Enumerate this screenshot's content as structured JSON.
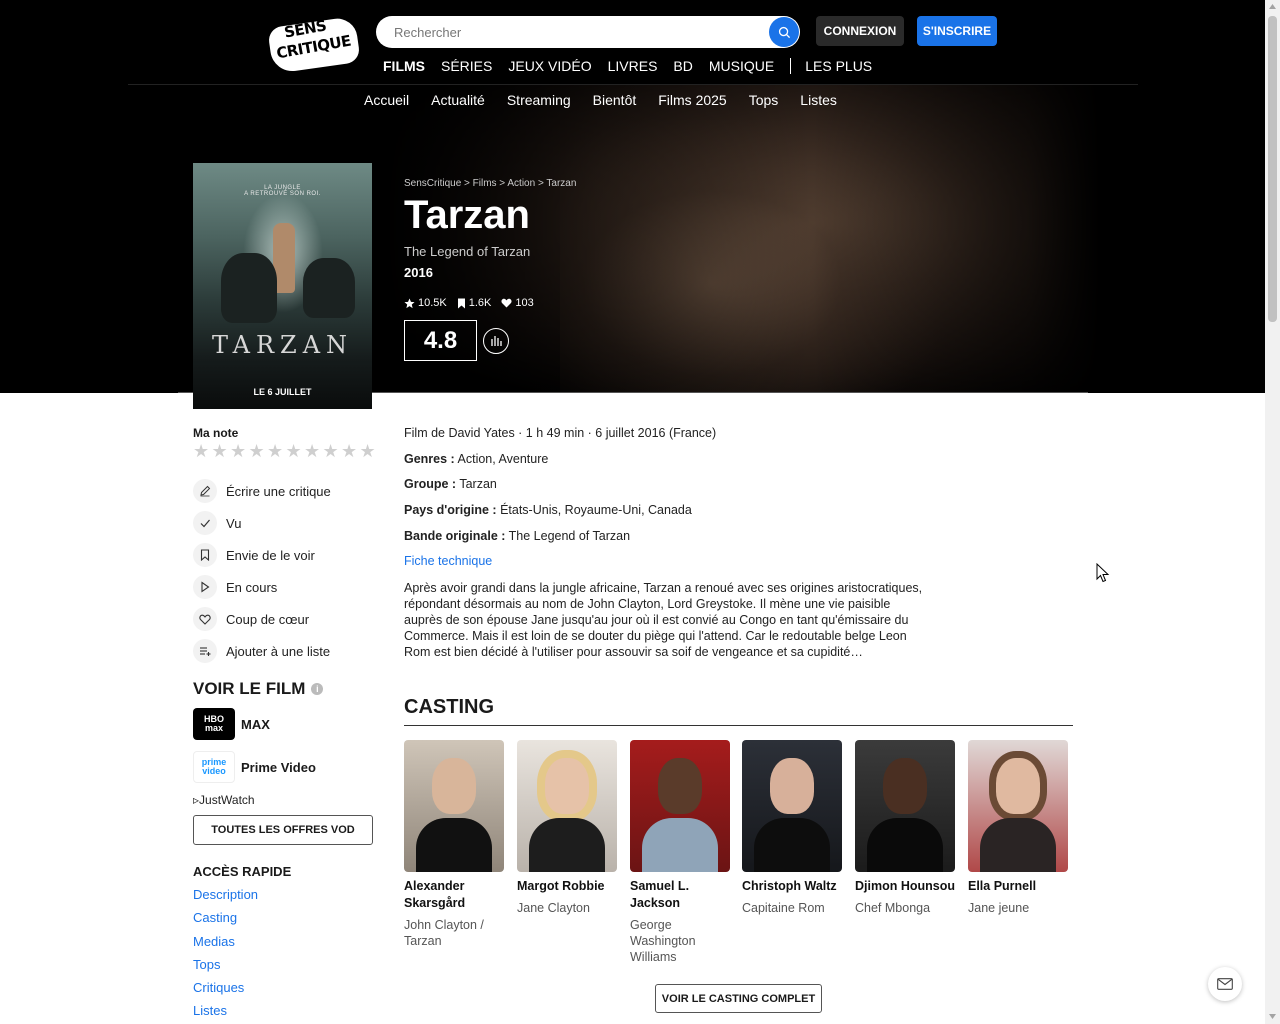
{
  "header": {
    "logo_line1": "SENS",
    "logo_line2": "CRITIQUE",
    "search_placeholder": "Rechercher",
    "login_label": "CONNEXION",
    "signup_label": "S'INSCRIRE",
    "main_nav": [
      "FILMS",
      "SÉRIES",
      "JEUX VIDÉO",
      "LIVRES",
      "BD",
      "MUSIQUE",
      "LES PLUS"
    ],
    "sub_nav": [
      "Accueil",
      "Actualité",
      "Streaming",
      "Bientôt",
      "Films 2025",
      "Tops",
      "Listes"
    ]
  },
  "poster": {
    "tagline_line1": "LA JUNGLE",
    "tagline_line2": "A RETROUVÉ SON ROI.",
    "title": "TARZAN",
    "date": "LE 6 JUILLET"
  },
  "film": {
    "breadcrumb": "SensCritique > Films > Action > Tarzan",
    "title": "Tarzan",
    "original_title": "The Legend of Tarzan",
    "year": "2016",
    "ratings_count": "10.5K",
    "wishlist_count": "1.6K",
    "favorites_count": "103",
    "average_rating": "4.8",
    "meta": "Film de David Yates · 1 h 49 min · 6 juillet 2016 (France)",
    "genres_label": "Genres :",
    "genres": "Action, Aventure",
    "group_label": "Groupe :",
    "group": "Tarzan",
    "countries_label": "Pays d'origine :",
    "countries": "États-Unis, Royaume-Uni, Canada",
    "soundtrack_label": "Bande originale :",
    "soundtrack": "The Legend of Tarzan",
    "fiche_link": "Fiche technique",
    "synopsis": "Après avoir grandi dans la jungle africaine, Tarzan a renoué avec ses origines aristocratiques, répondant désormais au nom de John Clayton, Lord Greystoke. Il mène une vie paisible auprès de son épouse Jane jusqu'au jour où il est convié au Congo en tant qu'émissaire du Commerce. Mais il est loin de se douter du piège qui l'attend. Car le redoutable belge Leon Rom est bien décidé à l'utiliser pour assouvir sa soif de vengeance et sa cupidité…"
  },
  "sidebar": {
    "my_rating_label": "Ma note",
    "actions": [
      {
        "label": "Écrire une critique",
        "icon": "pencil-icon"
      },
      {
        "label": "Vu",
        "icon": "check-icon"
      },
      {
        "label": "Envie de le voir",
        "icon": "bookmark-icon"
      },
      {
        "label": "En cours",
        "icon": "play-icon"
      },
      {
        "label": "Coup de cœur",
        "icon": "heart-icon"
      },
      {
        "label": "Ajouter à une liste",
        "icon": "list-add-icon"
      }
    ],
    "watch_title": "VOIR LE FILM",
    "providers": [
      {
        "name": "MAX",
        "logo_line1": "HBO",
        "logo_line2": "max"
      },
      {
        "name": "Prime Video",
        "logo_line1": "prime",
        "logo_line2": "video"
      }
    ],
    "justwatch": "JustWatch",
    "vod_button": "TOUTES LES OFFRES VOD",
    "quick_access_title": "ACCÈS RAPIDE",
    "quick_access": [
      "Description",
      "Casting",
      "Medias",
      "Tops",
      "Critiques",
      "Listes"
    ]
  },
  "casting": {
    "title": "CASTING",
    "members": [
      {
        "name": "Alexander Skarsgård",
        "role": "John Clayton / Tarzan"
      },
      {
        "name": "Margot Robbie",
        "role": "Jane Clayton"
      },
      {
        "name": "Samuel L. Jackson",
        "role": "George Washington Williams"
      },
      {
        "name": "Christoph Waltz",
        "role": "Capitaine Rom"
      },
      {
        "name": "Djimon Hounsou",
        "role": "Chef Mbonga"
      },
      {
        "name": "Ella Purnell",
        "role": "Jane jeune"
      }
    ],
    "full_button": "VOIR LE CASTING COMPLET"
  },
  "colors": {
    "accent": "#1a73e8",
    "header_bg": "#000000"
  }
}
